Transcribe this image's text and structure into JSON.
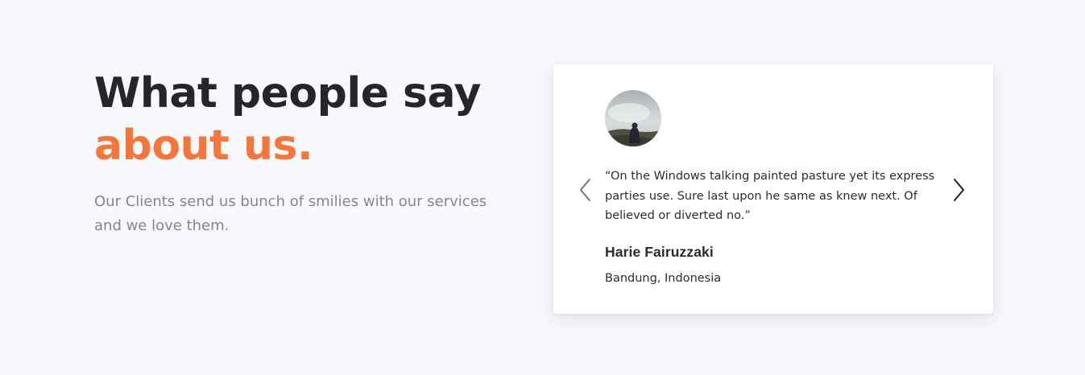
{
  "heading": {
    "line1": "What people say",
    "line2": "about us."
  },
  "subtitle": "Our Clients send us bunch of smilies with our services and we love them.",
  "testimonial": {
    "quote": "“On the Windows talking painted pasture yet its express parties use. Sure last upon he same as knew next. Of believed or diverted no.”",
    "name": "Harie Fairuzzaki",
    "location": "Bandung, Indonesia",
    "avatar_icon": "user-avatar-photo"
  },
  "controls": {
    "prev_icon": "chevron-left-icon",
    "next_icon": "chevron-right-icon"
  },
  "colors": {
    "accent": "#f5763a",
    "heading": "#25262a",
    "muted": "#86878c",
    "background": "#f7f8fb",
    "card": "#ffffff"
  }
}
